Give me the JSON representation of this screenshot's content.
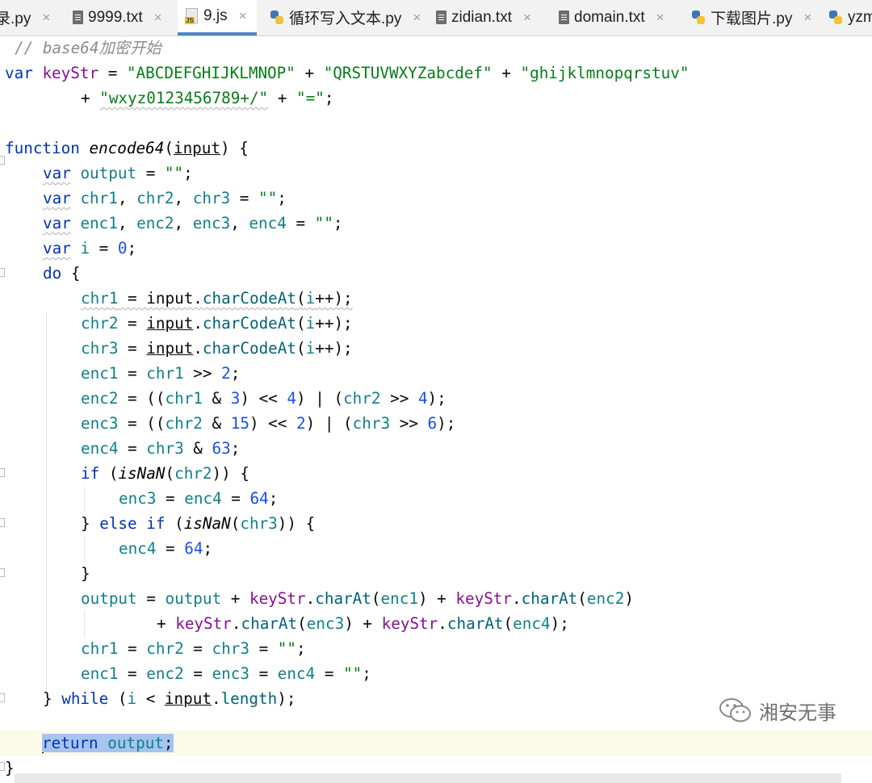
{
  "tabs": [
    {
      "label": "录.py",
      "icon": "python-file-icon",
      "active": false
    },
    {
      "label": "9999.txt",
      "icon": "text-file-icon",
      "active": false
    },
    {
      "label": "9.js",
      "icon": "javascript-file-icon",
      "active": true
    },
    {
      "label": "循环写入文本.py",
      "icon": "python-file-icon",
      "active": false
    },
    {
      "label": "zidian.txt",
      "icon": "text-file-icon",
      "active": false
    },
    {
      "label": "domain.txt",
      "icon": "text-file-icon",
      "active": false
    },
    {
      "label": "下载图片.py",
      "icon": "python-file-icon",
      "active": false
    },
    {
      "label": "yzm",
      "icon": "python-file-icon",
      "active": false
    }
  ],
  "tab_close_glyph": "×",
  "icon_js_label": "JS",
  "code": {
    "comment": "// base64加密开始",
    "keystr_part1": "\"ABCDEFGHIJKLMNOP\"",
    "keystr_part2": "\"QRSTUVWXYZabcdef\"",
    "keystr_part3": "\"ghijklmnopqrstuv\"",
    "keystr_part4": "\"wxyz0123456789+/\"",
    "keystr_part5": "\"=\"",
    "function_name": "encode64",
    "param": "input",
    "empty_string": "\"\"",
    "num_0": "0",
    "num_2": "2",
    "num_3": "3",
    "num_4": "4",
    "num_15": "15",
    "num_6": "6",
    "num_63": "63",
    "num_64": "64"
  },
  "watermark": {
    "text": "湘安无事",
    "icon": "wechat-icon"
  },
  "colors": {
    "keyword": "#0033b3",
    "string": "#067d17",
    "number": "#1750eb",
    "local_var": "#0f7f8a",
    "global_var": "#871094",
    "selection": "#a6c4ef",
    "active_tab_underline": "#4a88c7"
  }
}
